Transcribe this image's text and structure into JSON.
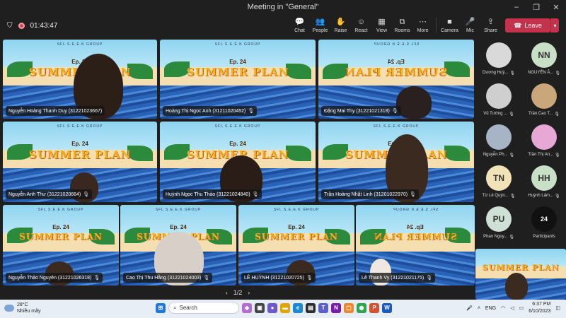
{
  "window": {
    "title": "Meeting in \"General\"",
    "min": "–",
    "max": "❐",
    "close": "✕"
  },
  "toolbar": {
    "timer": "01:43:47",
    "buttons": [
      {
        "label": "Chat",
        "icon": "chat-icon",
        "glyph": "💬"
      },
      {
        "label": "People",
        "icon": "people-icon",
        "glyph": "👥"
      },
      {
        "label": "Raise",
        "icon": "raise-hand-icon",
        "glyph": "✋"
      },
      {
        "label": "React",
        "icon": "react-icon",
        "glyph": "☺"
      },
      {
        "label": "View",
        "icon": "view-icon",
        "glyph": "▦"
      },
      {
        "label": "Rooms",
        "icon": "rooms-icon",
        "glyph": "⧉"
      },
      {
        "label": "More",
        "icon": "more-icon",
        "glyph": "⋯"
      },
      {
        "label": "Camera",
        "icon": "camera-icon",
        "glyph": "■"
      },
      {
        "label": "Mic",
        "icon": "mic-icon",
        "glyph": "🎤"
      },
      {
        "label": "Share",
        "icon": "share-icon",
        "glyph": "⇪"
      }
    ],
    "leave_label": "Leave"
  },
  "background_art": {
    "group": "SFL S.E.E.K GROUP",
    "episode": "Ep. 24",
    "title": "SUMMER PLAN"
  },
  "tiles": [
    {
      "name": "Nguyễn Hoàng Thanh Duy (31221023667)"
    },
    {
      "name": "Hoàng Thị Ngọc Anh (31211020452)"
    },
    {
      "name": "Đặng Mai Thy (31221021318)"
    },
    {
      "name": "Nguyễn Anh Thư (31221020664)"
    },
    {
      "name": "Huỳnh Ngọc Thu Thảo (31221024840)"
    },
    {
      "name": "Trần Hoàng Nhật Linh (31201022970)"
    },
    {
      "name": "Nguyễn Thảo Nguyên (31221026318)"
    },
    {
      "name": "Cao Thị Thu Hằng (31221024003)"
    },
    {
      "name": "LÊ HUỲNH (31221020725)"
    },
    {
      "name": "Lê Thanh Vy (31221021175)"
    }
  ],
  "pager": {
    "text": "1/2",
    "prev": "‹",
    "next": "›"
  },
  "roster": [
    {
      "name": "Dương Huỳ...",
      "initials": "",
      "color": "#d9d9d9"
    },
    {
      "name": "NGUYỄN Â...",
      "initials": "NN",
      "color": "#c8e0c6"
    },
    {
      "name": "Vũ Tường ...",
      "initials": "",
      "color": "#cfcfcf"
    },
    {
      "name": "Trần Cao T...",
      "initials": "",
      "color": "#c9a77a"
    },
    {
      "name": "Nguyễn Ph...",
      "initials": "",
      "color": "#a7b4c6"
    },
    {
      "name": "Trần Thị An...",
      "initials": "",
      "color": "#e7a8d6"
    },
    {
      "name": "Từ Lê Quỳn...",
      "initials": "TN",
      "color": "#f2e2b8"
    },
    {
      "name": "Huỳnh Lâm...",
      "initials": "HH",
      "color": "#c8e0c6"
    },
    {
      "name": "Phan Nguy...",
      "initials": "PU",
      "color": "#cfe0d6"
    },
    {
      "name": "Participants",
      "initials": "24",
      "color": "#111111"
    }
  ],
  "taskbar": {
    "temp": "28°C",
    "weather": "Nhiều mây",
    "search": "Search",
    "lang": "ENG",
    "time": "6:37 PM",
    "date": "6/10/2023"
  }
}
